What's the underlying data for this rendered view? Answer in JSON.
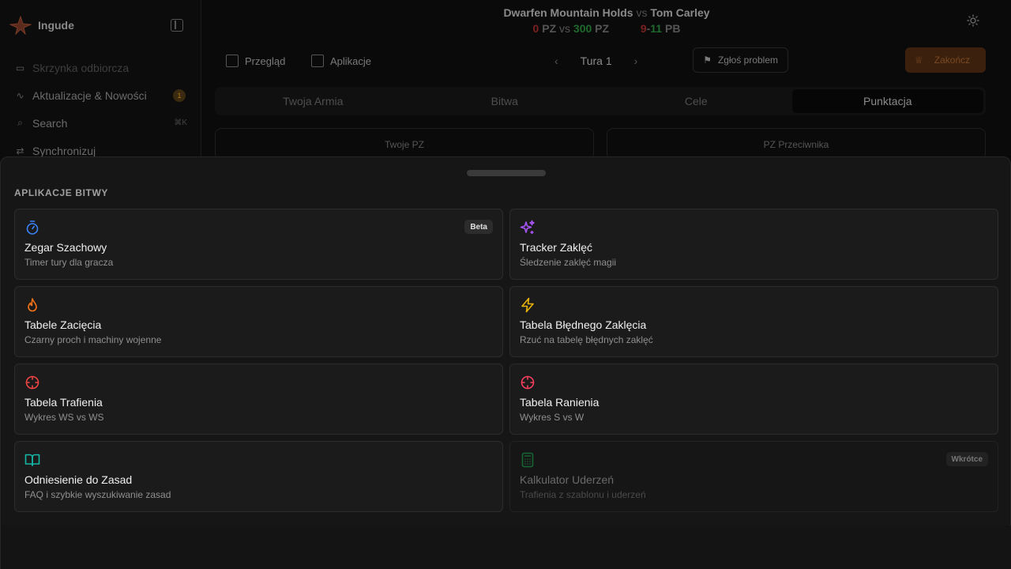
{
  "sidebar": {
    "brand": "Ingude",
    "items": [
      {
        "label": "Skrzynka odbiorcza",
        "icon": "inbox-icon"
      },
      {
        "label": "Aktualizacje & Nowości",
        "icon": "activity-icon",
        "badge": "1"
      },
      {
        "label": "Search",
        "icon": "search-icon",
        "shortcut": "⌘K"
      },
      {
        "label": "Synchronizuj",
        "icon": "sync-icon"
      }
    ]
  },
  "header": {
    "player": "Dwarfen Mountain Holds",
    "vs": "vs",
    "opponent": "Tom Carley",
    "player_pz": "0",
    "pz_label": "PZ",
    "score_vs": "vs",
    "opponent_pz": "300",
    "pb_left": "9",
    "pb_dash": "-",
    "pb_right": "11",
    "pb_label": "PB"
  },
  "toolbar": {
    "overview": "Przegląd",
    "apps": "Aplikacje",
    "turn": "Tura 1",
    "report": "Zgłoś problem",
    "finish": "Zakończ"
  },
  "tabs": [
    "Twoja Armia",
    "Bitwa",
    "Cele",
    "Punktacja"
  ],
  "pz_cards": [
    "Twoje PZ",
    "PZ Przeciwnika"
  ],
  "drawer": {
    "title": "APLIKACJE BITWY",
    "apps": [
      {
        "title": "Zegar Szachowy",
        "subtitle": "Timer tury dla gracza",
        "icon": "timer-icon",
        "color": "#3b82f6",
        "tag": "Beta"
      },
      {
        "title": "Tracker Zaklęć",
        "subtitle": "Śledzenie zaklęć magii",
        "icon": "sparkles-icon",
        "color": "#a855f7",
        "tag": ""
      },
      {
        "title": "Tabele Zacięcia",
        "subtitle": "Czarny proch i machiny wojenne",
        "icon": "flame-icon",
        "color": "#f97316",
        "tag": ""
      },
      {
        "title": "Tabela Błędnego Zaklęcia",
        "subtitle": "Rzuć na tabelę błędnych zaklęć",
        "icon": "zap-icon",
        "color": "#eab308",
        "tag": ""
      },
      {
        "title": "Tabela Trafienia",
        "subtitle": "Wykres WS vs WS",
        "icon": "crosshair-icon",
        "color": "#ef4444",
        "tag": ""
      },
      {
        "title": "Tabela Ranienia",
        "subtitle": "Wykres S vs W",
        "icon": "crosshair-icon",
        "color": "#f43f5e",
        "tag": ""
      },
      {
        "title": "Odniesienie do Zasad",
        "subtitle": "FAQ i szybkie wyszukiwanie zasad",
        "icon": "book-open-icon",
        "color": "#14b8a6",
        "tag": ""
      },
      {
        "title": "Kalkulator Uderzeń",
        "subtitle": "Trafienia z szablonu i uderzeń",
        "icon": "calculator-icon",
        "color": "#166534",
        "tag": "Wkrótce",
        "disabled": true
      }
    ]
  }
}
